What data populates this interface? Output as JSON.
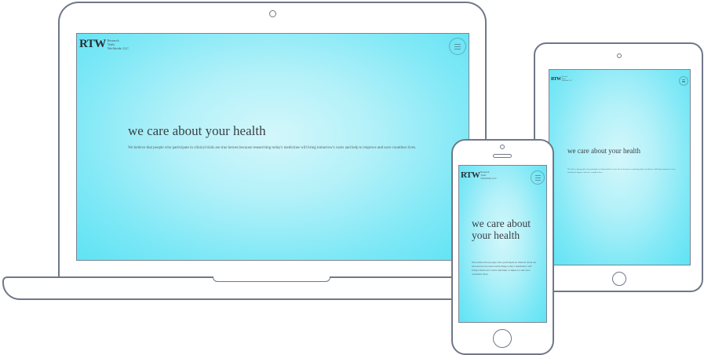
{
  "logo": {
    "mark": "RTW",
    "line1": "Research",
    "line2": "Trials",
    "line3": "Worldwide, LLC"
  },
  "hero": {
    "title": "we care about your health",
    "text": "We believe that people who participate in clinical trials are true heroes because researching today's medicines will bring tomorrow's cures and help to improve and save countless lives."
  },
  "icons": {
    "menu": "hamburger-menu-icon"
  },
  "colors": {
    "accent": "#5ee3f4",
    "device_outline": "#6f7888"
  }
}
